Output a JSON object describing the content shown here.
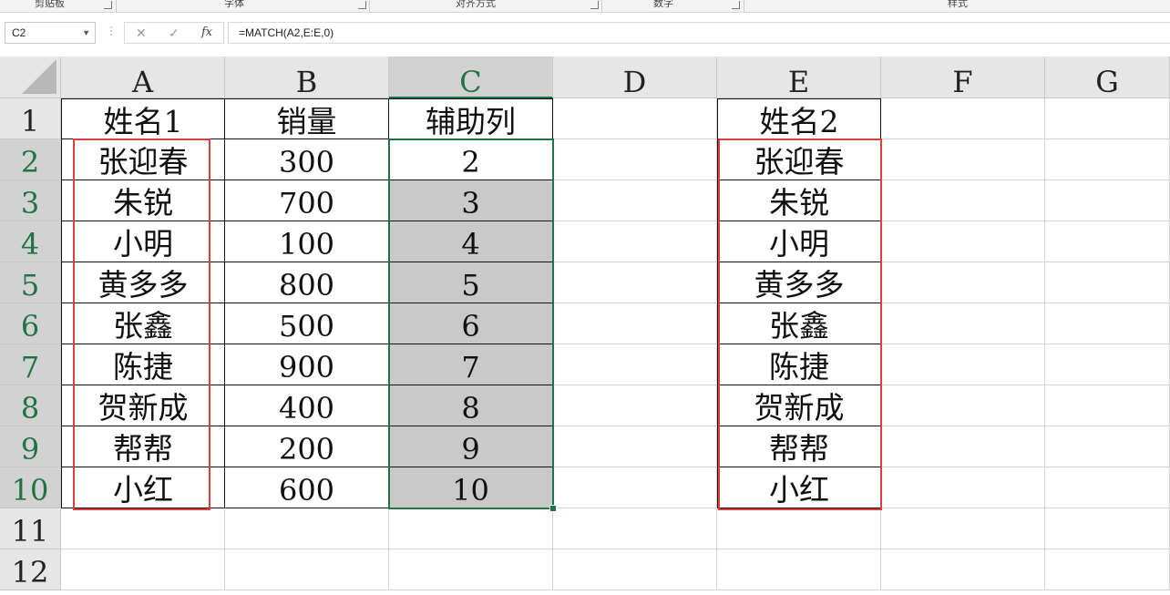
{
  "ribbon": {
    "groups": [
      "剪贴板",
      "字体",
      "对齐方式",
      "数字",
      "样式"
    ]
  },
  "formula_bar": {
    "name_box": "C2",
    "cancel_icon": "✕",
    "enter_icon": "✓",
    "fx_label": "fx",
    "formula": "=MATCH(A2,E:E,0)"
  },
  "sheet": {
    "columns": [
      "A",
      "B",
      "C",
      "D",
      "E",
      "F",
      "G"
    ],
    "rows": [
      "1",
      "2",
      "3",
      "4",
      "5",
      "6",
      "7",
      "8",
      "9",
      "10",
      "11",
      "12"
    ],
    "selected_cell": "C2",
    "selected_range": "C2:C10",
    "table1": {
      "headers": [
        "姓名1",
        "销量",
        "辅助列"
      ],
      "rows": [
        [
          "张迎春",
          "300",
          "2"
        ],
        [
          "朱锐",
          "700",
          "3"
        ],
        [
          "小明",
          "100",
          "4"
        ],
        [
          "黄多多",
          "800",
          "5"
        ],
        [
          "张鑫",
          "500",
          "6"
        ],
        [
          "陈捷",
          "900",
          "7"
        ],
        [
          "贺新成",
          "400",
          "8"
        ],
        [
          "帮帮",
          "200",
          "9"
        ],
        [
          "小红",
          "600",
          "10"
        ]
      ]
    },
    "table2": {
      "header": "姓名2",
      "values": [
        "张迎春",
        "朱锐",
        "小明",
        "黄多多",
        "张鑫",
        "陈捷",
        "贺新成",
        "帮帮",
        "小红"
      ]
    }
  },
  "colors": {
    "highlight_red": "#e03c3c",
    "selection_green": "#217346",
    "range_fill": "#c9c9c9"
  }
}
